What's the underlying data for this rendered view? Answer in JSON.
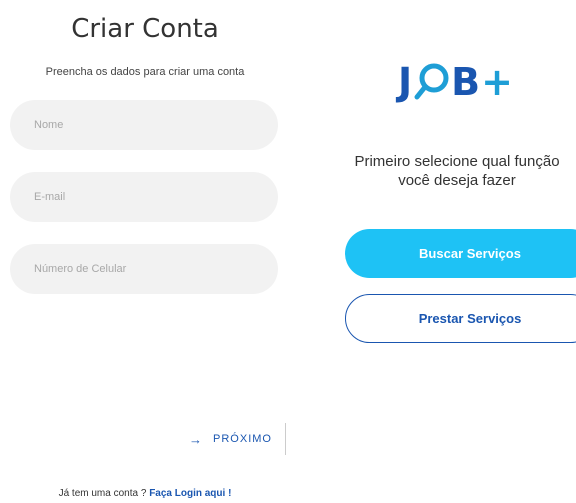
{
  "signup": {
    "title": "Criar Conta",
    "subtitle": "Preencha os dados para criar uma conta",
    "fields": [
      {
        "placeholder": "Nome",
        "value": ""
      },
      {
        "placeholder": "E-mail",
        "value": ""
      },
      {
        "placeholder": "Número de Celular",
        "value": ""
      }
    ],
    "next_label": "PRÓXIMO",
    "next_icon": "arrow-right-icon",
    "login_prompt": "Já tem uma conta ?",
    "login_link": "Faça Login aqui !"
  },
  "role_select": {
    "logo": {
      "part1": "J",
      "part2": "B",
      "part3": "+"
    },
    "prompt_line1": "Primeiro selecione qual função",
    "prompt_line2": "você deseja fazer",
    "primary_button": "Buscar Serviços",
    "secondary_button": "Prestar Serviços"
  },
  "colors": {
    "brand_blue": "#1a56b0",
    "accent_cyan": "#1ec2f5",
    "field_bg": "#f2f2f2"
  }
}
